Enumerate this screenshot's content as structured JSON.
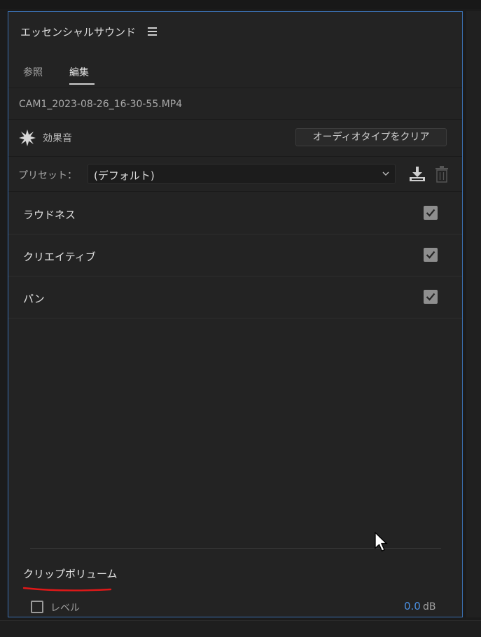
{
  "panel": {
    "title": "エッセンシャルサウンド",
    "menu_icon": "hamburger-menu-icon"
  },
  "tabs": [
    {
      "label": "参照",
      "active": false
    },
    {
      "label": "編集",
      "active": true
    }
  ],
  "clip_name": "CAM1_2023-08-26_16-30-55.MP4",
  "audio_type": {
    "icon": "burst-icon",
    "label": "効果音",
    "clear_button": "オーディオタイプをクリア"
  },
  "preset": {
    "label": "プリセット：",
    "value": "(デフォルト)",
    "download_icon": "download-icon",
    "delete_icon": "trash-icon"
  },
  "sections": [
    {
      "label": "ラウドネス",
      "checked": true
    },
    {
      "label": "クリエイティブ",
      "checked": true
    },
    {
      "label": "パン",
      "checked": true
    }
  ],
  "clip_volume": {
    "heading": "クリップボリューム",
    "level_label": "レベル",
    "level_checked": false,
    "level_value": "0.0",
    "level_unit": "dB"
  },
  "colors": {
    "accent_blue": "#4a8fe0",
    "panel_border": "#3a6fb0",
    "annotation_red": "#e01818"
  }
}
